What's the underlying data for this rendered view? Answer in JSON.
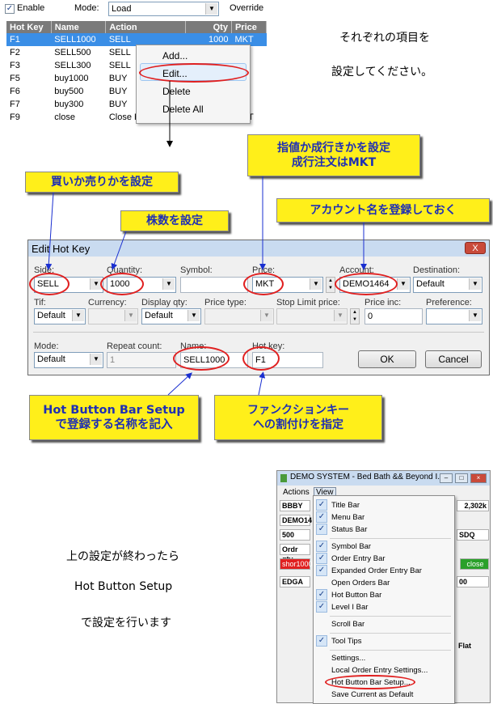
{
  "top": {
    "enable_label": "Enable",
    "mode_label": "Mode:",
    "mode_value": "Load",
    "override_label": "Override",
    "columns": [
      "Hot Key",
      "Name",
      "Action",
      "Qty",
      "Price"
    ],
    "rows": [
      [
        "F1",
        "SELL1000",
        "SELL",
        "1000",
        "MKT"
      ],
      [
        "F2",
        "SELL500",
        "SELL",
        "",
        ""
      ],
      [
        "F3",
        "SELL300",
        "SELL",
        "",
        ""
      ],
      [
        "F5",
        "buy1000",
        "BUY",
        "",
        ""
      ],
      [
        "F6",
        "buy500",
        "BUY",
        "",
        ""
      ],
      [
        "F7",
        "buy300",
        "BUY",
        "",
        ""
      ],
      [
        "F9",
        "close",
        "Close Pos",
        "",
        "MKT"
      ]
    ],
    "context_menu": [
      "Add...",
      "Edit...",
      "Delete",
      "Delete All"
    ]
  },
  "instructions_right": [
    "それぞれの項目を",
    "設定してください。"
  ],
  "callouts": {
    "side": "買いか売りかを設定",
    "qty": "株数を設定",
    "price_line1": "指値か成行きかを設定",
    "price_line2": "成行注文はMKT",
    "account": "アカウント名を登録しておく",
    "name_line1": "Hot Button Bar Setup",
    "name_line2": "で登録する名称を記入",
    "hotkey_line1": "ファンクションキー",
    "hotkey_line2": "への割付けを指定"
  },
  "dialog": {
    "title": "Edit Hot Key",
    "close": "X",
    "labels": {
      "side": "Side:",
      "quantity": "Quantity:",
      "symbol": "Symbol:",
      "price": "Price:",
      "account": "Account:",
      "destination": "Destination:",
      "tif": "Tif:",
      "currency": "Currency:",
      "display_qty": "Display qty:",
      "price_type": "Price type:",
      "stop_limit_price": "Stop Limit price:",
      "price_inc": "Price inc:",
      "preference": "Preference:",
      "mode": "Mode:",
      "repeat_count": "Repeat count:",
      "name": "Name:",
      "hot_key": "Hot key:"
    },
    "values": {
      "side": "SELL",
      "quantity": "1000",
      "symbol": "",
      "price": "MKT",
      "account": "DEMO1464",
      "destination": "Default",
      "tif": "Default",
      "currency": "",
      "display_qty": "Default",
      "price_type": "",
      "stop_limit_price": "",
      "price_inc": "0",
      "preference": "",
      "mode": "Default",
      "repeat_count": "1",
      "name": "SELL1000",
      "hot_key": "F1"
    },
    "ok": "OK",
    "cancel": "Cancel"
  },
  "instructions_bottom": [
    "上の設定が終わったら",
    "Hot Button Setup",
    "で設定を行います"
  ],
  "app": {
    "title": "DEMO SYSTEM - Bed Bath && Beyond I...",
    "menu": [
      "Actions",
      "View"
    ],
    "symbol": "BBBY",
    "account": "DEMO14",
    "qty": "500",
    "volume": "2,302k",
    "ordr_qty": "Ordr qty",
    "exchange": "SDQ",
    "short_btn": "shor1000",
    "close_btn": "close",
    "edga": "EDGA",
    "col_val": "00",
    "flat": "Flat"
  },
  "view_menu": [
    {
      "label": "Title Bar",
      "checked": true
    },
    {
      "label": "Menu Bar",
      "checked": true
    },
    {
      "label": "Status Bar",
      "checked": true
    },
    {
      "label": "Symbol Bar",
      "checked": true
    },
    {
      "label": "Order Entry Bar",
      "checked": true
    },
    {
      "label": "Expanded Order Entry Bar",
      "checked": true
    },
    {
      "label": "Open Orders Bar",
      "checked": false
    },
    {
      "label": "Hot Button Bar",
      "checked": true
    },
    {
      "label": "Level I Bar",
      "checked": true
    },
    {
      "label": "Scroll Bar",
      "checked": false
    },
    {
      "label": "Tool Tips",
      "checked": true
    },
    {
      "label": "Settings...",
      "checked": false
    },
    {
      "label": "Local Order Entry Settings...",
      "checked": false
    },
    {
      "label": "Hot Button Bar Setup...",
      "checked": false
    },
    {
      "label": "Save Current as Default",
      "checked": false
    }
  ]
}
